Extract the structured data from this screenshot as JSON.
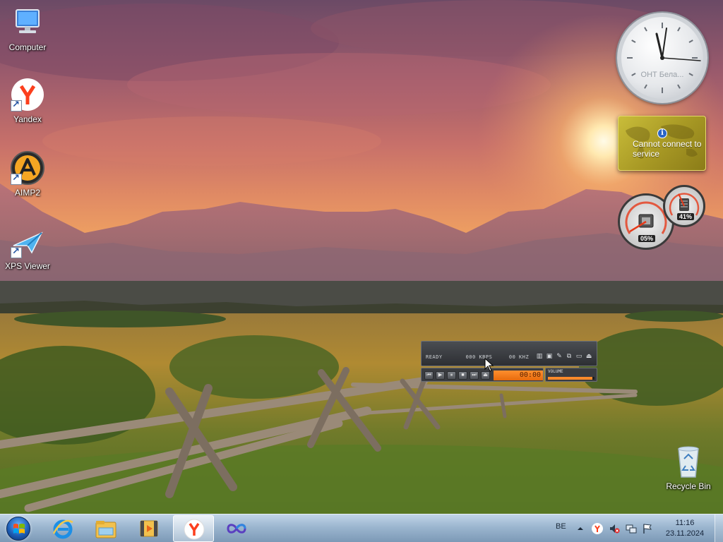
{
  "desktop": {
    "icons": [
      {
        "label": "Computer",
        "icon": "computer-icon"
      },
      {
        "label": "Yandex",
        "icon": "yandex-browser-icon"
      },
      {
        "label": "AIMP2",
        "icon": "aimp-icon"
      },
      {
        "label": "XPS Viewer",
        "icon": "xps-viewer-icon"
      },
      {
        "label": "Recycle Bin",
        "icon": "recycle-bin-icon"
      }
    ]
  },
  "gadgets": {
    "clock": {
      "caption": "ОНТ Бела..."
    },
    "weather": {
      "message": "Cannot connect to service",
      "icon": "info-icon"
    },
    "cpu_meter": {
      "cpu": "05%",
      "memory": "41%",
      "cpu_level": 0.05,
      "memory_level": 0.41
    }
  },
  "aimp_player": {
    "status": "READY",
    "bitrate": "000 KBPS",
    "frequency": "00 KHZ",
    "time": "00:00",
    "volume_label": "VOLUME",
    "volume_level": 0.95,
    "accent": "#ff8a2a"
  },
  "taskbar": {
    "pinned": [
      {
        "name": "internet-explorer-icon"
      },
      {
        "name": "windows-explorer-icon"
      },
      {
        "name": "media-player-icon"
      },
      {
        "name": "yandex-browser-icon",
        "active": true
      },
      {
        "name": "infinity-icon"
      }
    ],
    "language": "BE",
    "tray_icons": [
      "show-hidden-icons-icon",
      "yandex-tray-icon",
      "volume-muted-icon",
      "network-icon",
      "action-center-flag-icon"
    ],
    "time": "11:16",
    "date": "23.11.2024"
  }
}
